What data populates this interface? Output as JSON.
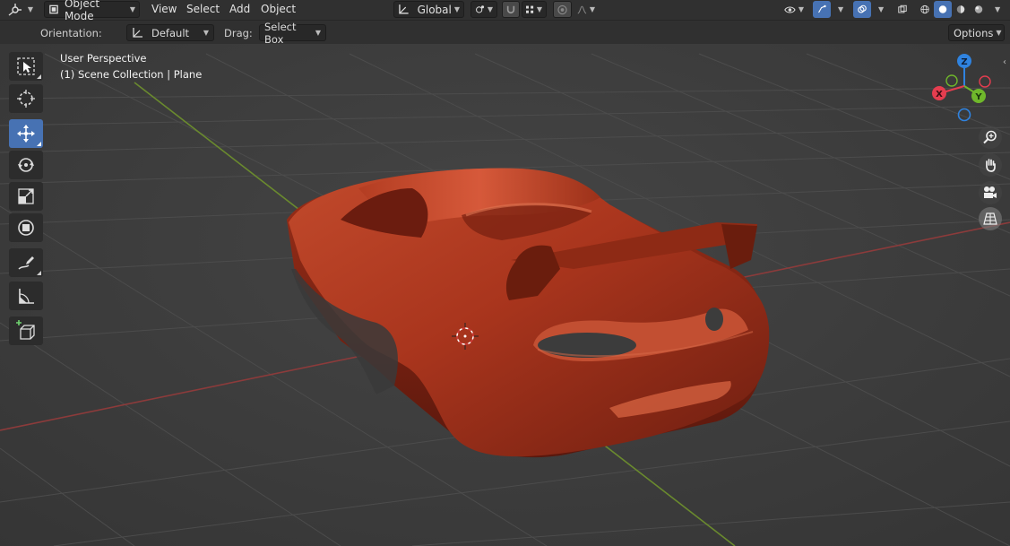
{
  "header": {
    "mode": "Object Mode",
    "menus": [
      "View",
      "Select",
      "Add",
      "Object"
    ],
    "transform_orientation": "Global"
  },
  "tool_settings": {
    "orientation_label": "Orientation:",
    "orientation_value": "Default",
    "drag_label": "Drag:",
    "drag_value": "Select Box",
    "options_label": "Options"
  },
  "viewport": {
    "perspective": "User Perspective",
    "collection_info": "(1) Scene Collection | Plane",
    "axis_labels": {
      "x": "X",
      "y": "Y",
      "z": "Z"
    }
  },
  "toolbar": {
    "tools": [
      "select-box",
      "cursor",
      "move",
      "rotate",
      "scale",
      "transform",
      "annotate",
      "measure",
      "add-cube"
    ],
    "active": "move"
  },
  "colors": {
    "accent": "#4772b3",
    "axis_x": "#e53d4f",
    "axis_y": "#6fb72b",
    "axis_z": "#2f83e0",
    "car_body": "#a9351d"
  }
}
